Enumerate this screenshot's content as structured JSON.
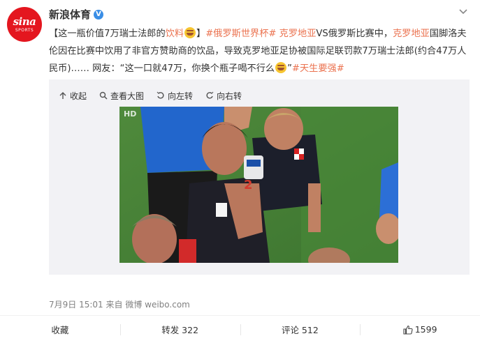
{
  "account": {
    "name": "新浪体育",
    "verified_badge": "V",
    "avatar_logo": "sina",
    "avatar_sub": "SPORTS"
  },
  "post": {
    "segments": [
      {
        "text": "【这一瓶价值7万瑞士法郎的",
        "type": "plain"
      },
      {
        "text": "饮料",
        "type": "topic"
      },
      {
        "emoji": "laugh-cry"
      },
      {
        "text": "】",
        "type": "plain"
      },
      {
        "text": "#俄罗斯世界杯#",
        "type": "tag"
      },
      {
        "text": " ",
        "type": "plain"
      },
      {
        "text": "克罗地亚",
        "type": "topic"
      },
      {
        "text": "VS俄罗斯比赛中，",
        "type": "plain"
      },
      {
        "text": "克罗地亚",
        "type": "topic"
      },
      {
        "text": "国脚洛夫伦因在比赛中饮用了非官方赞助商的饮品，导致克罗地亚足协被国际足联罚款7万瑞士法郎(约合47万人民币)…… 网友：“这一口就47万，你换个瓶子喝不行么",
        "type": "plain"
      },
      {
        "emoji": "laugh-cry"
      },
      {
        "text": "”",
        "type": "plain"
      },
      {
        "text": "#天生要强#",
        "type": "tag"
      }
    ]
  },
  "media_toolbar": {
    "collapse": "收起",
    "view_large": "查看大图",
    "rotate_left": "向左转",
    "rotate_right": "向右转"
  },
  "meta": {
    "timestamp": "7月9日 15:01",
    "source": "来自 微博 weibo.com"
  },
  "actions": {
    "favorite": "收藏",
    "repost": "转发 322",
    "comment": "评论 512",
    "like": "1599"
  },
  "photo": {
    "watermark": "HD",
    "jersey_number": "2"
  },
  "colors": {
    "brand": "#e4161f",
    "link": "#eb7350",
    "verified": "#3a8ee6"
  }
}
